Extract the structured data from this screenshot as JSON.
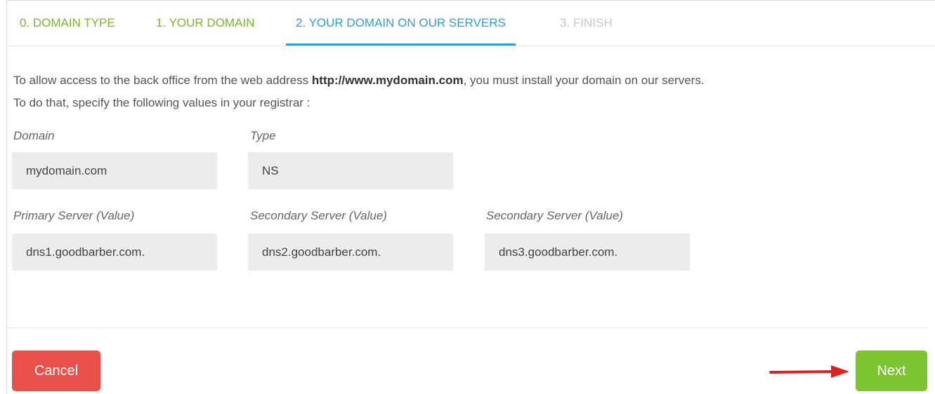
{
  "tabs": [
    {
      "label": "0. DOMAIN TYPE",
      "state": "done"
    },
    {
      "label": "1. YOUR DOMAIN",
      "state": "done"
    },
    {
      "label": "2. YOUR DOMAIN ON OUR SERVERS",
      "state": "active"
    },
    {
      "label": "3. FINISH",
      "state": "disabled"
    }
  ],
  "intro": {
    "line1_prefix": "To allow access to the back office from the web address ",
    "line1_url": "http://www.mydomain.com",
    "line1_suffix": ", you must install your domain on our servers.",
    "line2": "To do that, specify the following values in your registrar :"
  },
  "fields": {
    "domain": {
      "label": "Domain",
      "value": "mydomain.com"
    },
    "type": {
      "label": "Type",
      "value": "NS"
    },
    "primary": {
      "label": "Primary Server (Value)",
      "value": "dns1.goodbarber.com."
    },
    "secondary1": {
      "label": "Secondary Server (Value)",
      "value": "dns2.goodbarber.com."
    },
    "secondary2": {
      "label": "Secondary Server (Value)",
      "value": "dns3.goodbarber.com."
    }
  },
  "buttons": {
    "cancel": "Cancel",
    "next": "Next"
  },
  "colors": {
    "done_tab": "#7ab828",
    "active_tab": "#2fa0d4",
    "disabled_tab": "#c8c8c8",
    "cancel_button": "#e8514a",
    "next_button": "#7cc531",
    "arrow": "#e02020",
    "field_bg": "#ececec"
  },
  "icons": {
    "pointer": "red-arrow-icon"
  }
}
